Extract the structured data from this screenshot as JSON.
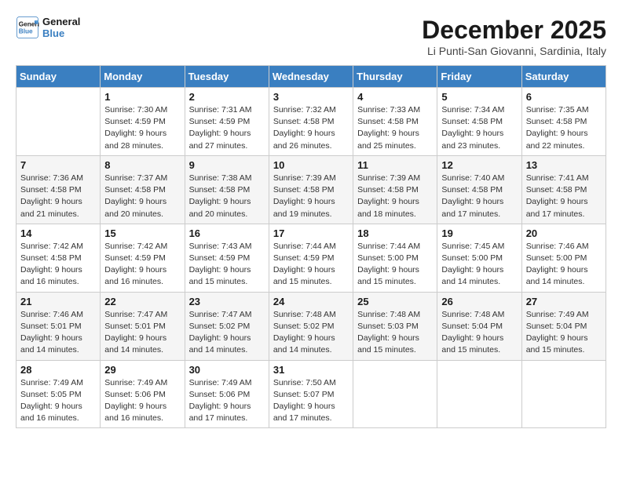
{
  "header": {
    "logo_line1": "General",
    "logo_line2": "Blue",
    "month_title": "December 2025",
    "location": "Li Punti-San Giovanni, Sardinia, Italy"
  },
  "days_of_week": [
    "Sunday",
    "Monday",
    "Tuesday",
    "Wednesday",
    "Thursday",
    "Friday",
    "Saturday"
  ],
  "weeks": [
    [
      {
        "num": "",
        "info": ""
      },
      {
        "num": "1",
        "info": "Sunrise: 7:30 AM\nSunset: 4:59 PM\nDaylight: 9 hours\nand 28 minutes."
      },
      {
        "num": "2",
        "info": "Sunrise: 7:31 AM\nSunset: 4:59 PM\nDaylight: 9 hours\nand 27 minutes."
      },
      {
        "num": "3",
        "info": "Sunrise: 7:32 AM\nSunset: 4:58 PM\nDaylight: 9 hours\nand 26 minutes."
      },
      {
        "num": "4",
        "info": "Sunrise: 7:33 AM\nSunset: 4:58 PM\nDaylight: 9 hours\nand 25 minutes."
      },
      {
        "num": "5",
        "info": "Sunrise: 7:34 AM\nSunset: 4:58 PM\nDaylight: 9 hours\nand 23 minutes."
      },
      {
        "num": "6",
        "info": "Sunrise: 7:35 AM\nSunset: 4:58 PM\nDaylight: 9 hours\nand 22 minutes."
      }
    ],
    [
      {
        "num": "7",
        "info": "Sunrise: 7:36 AM\nSunset: 4:58 PM\nDaylight: 9 hours\nand 21 minutes."
      },
      {
        "num": "8",
        "info": "Sunrise: 7:37 AM\nSunset: 4:58 PM\nDaylight: 9 hours\nand 20 minutes."
      },
      {
        "num": "9",
        "info": "Sunrise: 7:38 AM\nSunset: 4:58 PM\nDaylight: 9 hours\nand 20 minutes."
      },
      {
        "num": "10",
        "info": "Sunrise: 7:39 AM\nSunset: 4:58 PM\nDaylight: 9 hours\nand 19 minutes."
      },
      {
        "num": "11",
        "info": "Sunrise: 7:39 AM\nSunset: 4:58 PM\nDaylight: 9 hours\nand 18 minutes."
      },
      {
        "num": "12",
        "info": "Sunrise: 7:40 AM\nSunset: 4:58 PM\nDaylight: 9 hours\nand 17 minutes."
      },
      {
        "num": "13",
        "info": "Sunrise: 7:41 AM\nSunset: 4:58 PM\nDaylight: 9 hours\nand 17 minutes."
      }
    ],
    [
      {
        "num": "14",
        "info": "Sunrise: 7:42 AM\nSunset: 4:58 PM\nDaylight: 9 hours\nand 16 minutes."
      },
      {
        "num": "15",
        "info": "Sunrise: 7:42 AM\nSunset: 4:59 PM\nDaylight: 9 hours\nand 16 minutes."
      },
      {
        "num": "16",
        "info": "Sunrise: 7:43 AM\nSunset: 4:59 PM\nDaylight: 9 hours\nand 15 minutes."
      },
      {
        "num": "17",
        "info": "Sunrise: 7:44 AM\nSunset: 4:59 PM\nDaylight: 9 hours\nand 15 minutes."
      },
      {
        "num": "18",
        "info": "Sunrise: 7:44 AM\nSunset: 5:00 PM\nDaylight: 9 hours\nand 15 minutes."
      },
      {
        "num": "19",
        "info": "Sunrise: 7:45 AM\nSunset: 5:00 PM\nDaylight: 9 hours\nand 14 minutes."
      },
      {
        "num": "20",
        "info": "Sunrise: 7:46 AM\nSunset: 5:00 PM\nDaylight: 9 hours\nand 14 minutes."
      }
    ],
    [
      {
        "num": "21",
        "info": "Sunrise: 7:46 AM\nSunset: 5:01 PM\nDaylight: 9 hours\nand 14 minutes."
      },
      {
        "num": "22",
        "info": "Sunrise: 7:47 AM\nSunset: 5:01 PM\nDaylight: 9 hours\nand 14 minutes."
      },
      {
        "num": "23",
        "info": "Sunrise: 7:47 AM\nSunset: 5:02 PM\nDaylight: 9 hours\nand 14 minutes."
      },
      {
        "num": "24",
        "info": "Sunrise: 7:48 AM\nSunset: 5:02 PM\nDaylight: 9 hours\nand 14 minutes."
      },
      {
        "num": "25",
        "info": "Sunrise: 7:48 AM\nSunset: 5:03 PM\nDaylight: 9 hours\nand 15 minutes."
      },
      {
        "num": "26",
        "info": "Sunrise: 7:48 AM\nSunset: 5:04 PM\nDaylight: 9 hours\nand 15 minutes."
      },
      {
        "num": "27",
        "info": "Sunrise: 7:49 AM\nSunset: 5:04 PM\nDaylight: 9 hours\nand 15 minutes."
      }
    ],
    [
      {
        "num": "28",
        "info": "Sunrise: 7:49 AM\nSunset: 5:05 PM\nDaylight: 9 hours\nand 16 minutes."
      },
      {
        "num": "29",
        "info": "Sunrise: 7:49 AM\nSunset: 5:06 PM\nDaylight: 9 hours\nand 16 minutes."
      },
      {
        "num": "30",
        "info": "Sunrise: 7:49 AM\nSunset: 5:06 PM\nDaylight: 9 hours\nand 17 minutes."
      },
      {
        "num": "31",
        "info": "Sunrise: 7:50 AM\nSunset: 5:07 PM\nDaylight: 9 hours\nand 17 minutes."
      },
      {
        "num": "",
        "info": ""
      },
      {
        "num": "",
        "info": ""
      },
      {
        "num": "",
        "info": ""
      }
    ]
  ]
}
